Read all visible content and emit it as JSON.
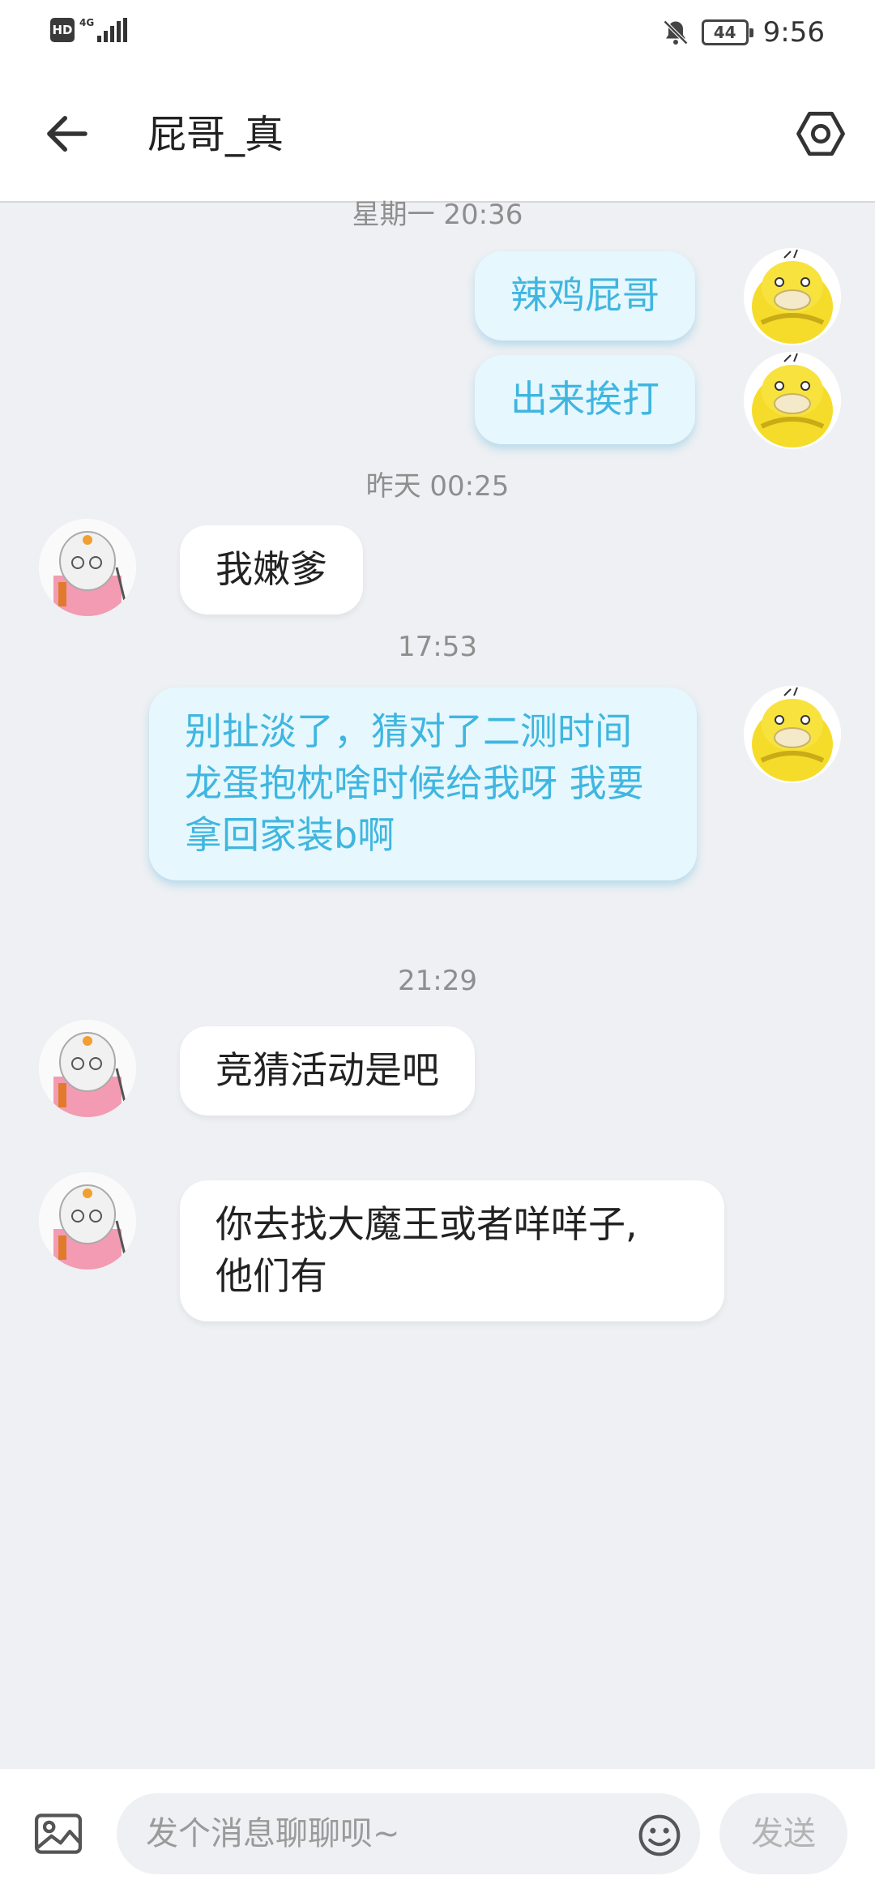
{
  "status_bar": {
    "hd": "HD",
    "network": "4G",
    "battery": "44",
    "time": "9:56"
  },
  "header": {
    "title": "屁哥_真",
    "back_icon": "arrow-left-icon",
    "settings_icon": "hexagon-settings-icon"
  },
  "messages": [
    {
      "type": "time",
      "text": "星期一 20:36"
    },
    {
      "type": "out",
      "text": "辣鸡屁哥"
    },
    {
      "type": "out",
      "text": "出来挨打"
    },
    {
      "type": "time",
      "text": "昨天 00:25"
    },
    {
      "type": "in",
      "text": "我嫩爹"
    },
    {
      "type": "time",
      "text": "17:53"
    },
    {
      "type": "out",
      "lines": [
        "别扯淡了，猜对了二测时间",
        "龙蛋抱枕啥时候给我呀 我要",
        "拿回家装b啊"
      ]
    },
    {
      "type": "time",
      "text": "21:29"
    },
    {
      "type": "in",
      "text": "竞猜活动是吧"
    },
    {
      "type": "in",
      "lines": [
        "你去找大魔王或者咩咩子,",
        "他们有"
      ]
    }
  ],
  "input": {
    "placeholder": "发个消息聊聊呗~",
    "send_label": "发送"
  },
  "colors": {
    "outgoing_text": "#3fb6e0",
    "outgoing_bubble": "#e6f7fd",
    "background": "#eef0f3"
  }
}
